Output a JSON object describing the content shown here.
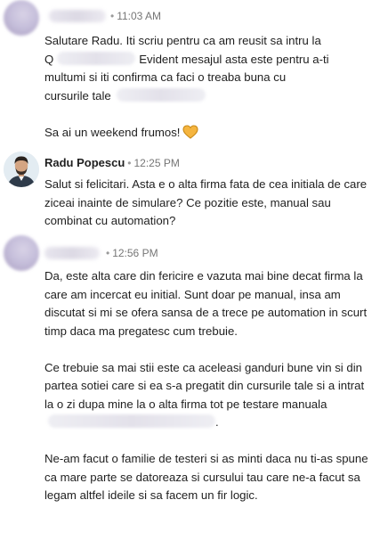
{
  "colors": {
    "timestamp": "#767676",
    "text": "#1f1f1f",
    "heart": "#f5b53f"
  },
  "messages": [
    {
      "sender": "",
      "time": "11:03 AM",
      "line1": "Salutare Radu. Iti scriu pentru ca am reusit sa intru la",
      "line2a": "Q",
      "line2b": "Evident mesajul asta este pentru a-ti",
      "line3": "multumi si iti confirma ca faci o treaba buna cu",
      "line4": "cursurile tale",
      "closing": "Sa ai un weekend frumos!",
      "closing_icon": "yellow-heart-icon"
    },
    {
      "sender": "Radu Popescu",
      "time": "12:25 PM",
      "paragraph": "Salut si felicitari. Asta e o alta firma fata de cea initiala de care ziceai inainte de simulare? Ce pozitie este, manual sau combinat cu automation?"
    },
    {
      "sender": "",
      "time": "12:56 PM",
      "p1": "Da, este alta care din fericire e vazuta mai bine decat firma la care am incercat eu initial. Sunt doar pe manual, insa am discutat si mi se ofera sansa de a trece pe automation in scurt timp daca ma pregatesc cum trebuie.",
      "p2": "Ce trebuie sa mai stii este ca aceleasi ganduri bune vin si din partea sotiei care si ea s-a pregatit din cursurile tale si a intrat la o zi dupa mine la o alta firma tot pe testare manuala",
      "p2_end": ".",
      "p3": "Ne-am facut o familie de testeri si as minti daca nu ti-as spune ca mare parte se datoreaza si cursului tau care ne-a facut sa legam altfel ideile si sa facem un fir logic."
    }
  ]
}
